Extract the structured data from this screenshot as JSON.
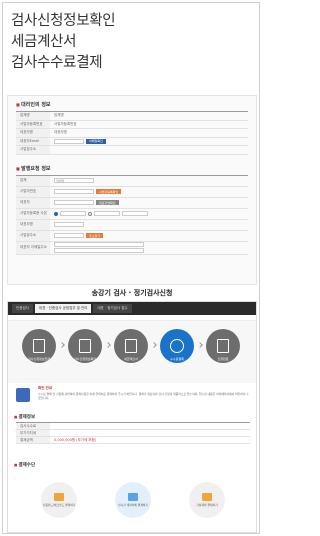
{
  "titles": [
    "검사신청정보확인",
    "세금계산서",
    "검사수수료결제"
  ],
  "panel1": {
    "sec1_title": "대리인의 정보",
    "sec1_rows": [
      {
        "label": "업체명",
        "value": "업체명",
        "type": "text"
      },
      {
        "label": "사업자등록번호",
        "value": "사업자등록번호",
        "type": "text"
      },
      {
        "label": "대표자명",
        "value": "대표자명",
        "type": "text"
      },
      {
        "label": "대표자Email",
        "value": "",
        "type": "input",
        "button": "이메일확인"
      },
      {
        "label": "사업장주소",
        "value": "",
        "type": "text"
      }
    ],
    "sec2_title": "발행요청 정보",
    "sec2_rows": [
      {
        "label": "업체",
        "value": "업체명"
      },
      {
        "label": "사업자번호",
        "value": "",
        "button": "사업자등록확인"
      },
      {
        "label": "대표자",
        "value": "",
        "button": "대표자명확인"
      },
      {
        "label": "사업자등록증 사본",
        "value": ""
      },
      {
        "label": "대표자명",
        "value": ""
      },
      {
        "label": "사업장주소",
        "value": "",
        "button": "주소찾기"
      },
      {
        "label": "대표자 이메일주소",
        "value": ""
      }
    ]
  },
  "link_title": "송강기 검사 · 정기검사신청",
  "browser": {
    "tabs": [
      "인증검사",
      "대표 · 인증검사 공정업무 및 관리",
      "대표 · 정기검사 접수"
    ]
  },
  "steps": [
    {
      "label": "검사신청정보입력",
      "active": false
    },
    {
      "label": "검사신청정보확인",
      "active": false
    },
    {
      "label": "세금계산서",
      "active": false
    },
    {
      "label": "수수료결제",
      "active": true
    },
    {
      "label": "신청완료",
      "active": false
    }
  ],
  "notice": {
    "title": "확인 안내",
    "body": "수수료 결제 및 신청에 관련하여 문의사항은 아래 연락처로 문의하여 주시기 바랍니다. 결제가 완료되면 검사 신청이 최종적으로 접수되며, 접수된 내용은 마이페이지에서 확인하실 수 있습니다."
  },
  "payinfo": {
    "title": "결제정보",
    "rows": [
      {
        "label": "검사수수료",
        "value": ""
      },
      {
        "label": "부가가치세",
        "value": ""
      },
      {
        "label": "결제금액",
        "value": "0,000,000원 (부가세 포함)",
        "red": true
      }
    ]
  },
  "paymethod": {
    "title": "결제수단",
    "options": [
      {
        "label": "신용카드/체크카드 결제하기",
        "active": false
      },
      {
        "label": "실시간 계좌이체 결제하기",
        "active": true
      },
      {
        "label": "가상계좌 결제하기",
        "active": false
      }
    ]
  }
}
